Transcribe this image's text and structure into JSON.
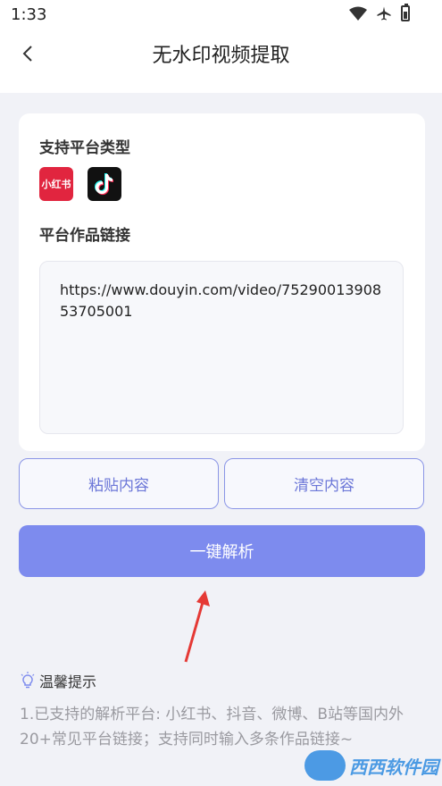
{
  "status": {
    "time": "1:33"
  },
  "header": {
    "title": "无水印视频提取"
  },
  "card": {
    "platform_label": "支持平台类型",
    "xhs_icon_text": "小红书",
    "link_label": "平台作品链接",
    "link_value": "https://www.douyin.com/video/7529001390853705001"
  },
  "buttons": {
    "paste": "粘贴内容",
    "clear": "清空内容",
    "parse": "一键解析"
  },
  "tips": {
    "title": "温馨提示",
    "text": "1.已支持的解析平台: 小红书、抖音、微博、B站等国内外20+常见平台链接；支持同时输入多条作品链接~"
  },
  "watermark": {
    "text": "西西软件园"
  },
  "colors": {
    "accent": "#7d8bee",
    "outline": "#8a95e6"
  }
}
